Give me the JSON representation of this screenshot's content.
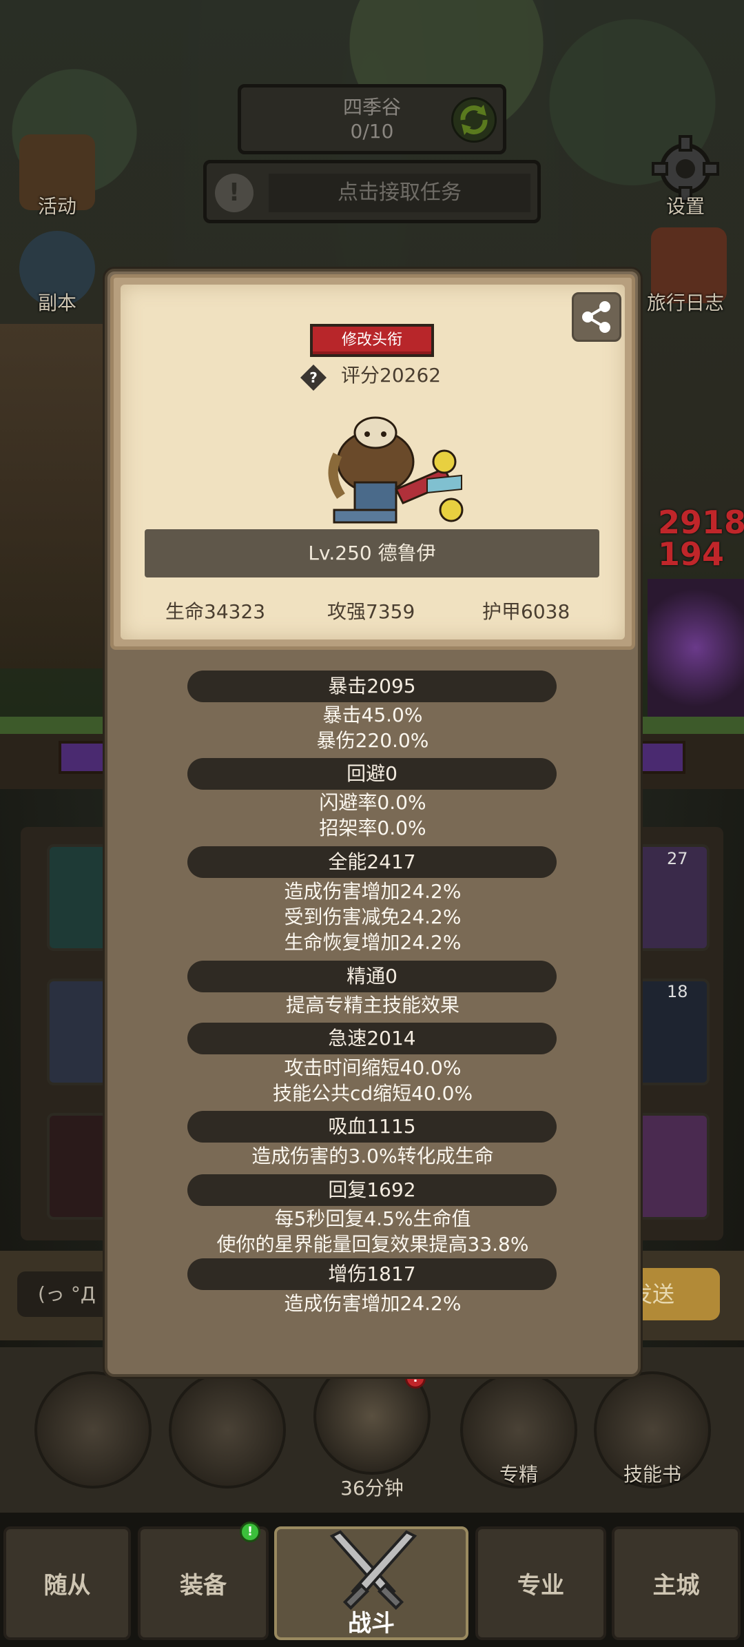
{
  "hud": {
    "map_name": "四季谷",
    "map_progress": "0/10",
    "quest_text": "点击接取任务",
    "quest_alert": "!"
  },
  "side_menu": {
    "activity": "活动",
    "dungeon": "副本",
    "settings": "设置",
    "travel_log": "旅行日志"
  },
  "background": {
    "damage_numbers": [
      "2918",
      "194"
    ],
    "tile_badges": [
      "27",
      "18"
    ],
    "chat_prefix": "(っ °Д °",
    "send_label": "发送",
    "timer": "36分钟",
    "round_buttons": [
      "",
      "",
      "",
      "专精",
      "技能书"
    ],
    "notification_count": "!"
  },
  "nav": {
    "tabs": [
      "随从",
      "装备",
      "战斗",
      "专业",
      "主城"
    ],
    "active": "战斗"
  },
  "profile": {
    "title_button": "修改头衔",
    "score": "评分20262",
    "help_glyph": "?",
    "name": "Lv.250 德鲁伊",
    "stats": {
      "hp": "生命34323",
      "attack": "攻强7359",
      "armor": "护甲6038"
    }
  },
  "sections": [
    {
      "title": "暴击2095",
      "lines": [
        "暴击45.0%",
        "暴伤220.0%"
      ]
    },
    {
      "title": "回避0",
      "lines": [
        "闪避率0.0%",
        "招架率0.0%"
      ]
    },
    {
      "title": "全能2417",
      "lines": [
        "造成伤害增加24.2%",
        "受到伤害减免24.2%",
        "生命恢复增加24.2%"
      ]
    },
    {
      "title": "精通0",
      "lines": [
        "提高专精主技能效果"
      ]
    },
    {
      "title": "急速2014",
      "lines": [
        "攻击时间缩短40.0%",
        "技能公共cd缩短40.0%"
      ]
    },
    {
      "title": "吸血1115",
      "lines": [
        "造成伤害的3.0%转化成生命"
      ]
    },
    {
      "title": "回复1692",
      "lines": [
        "每5秒回复4.5%生命值",
        "使你的星界能量回复效果提高33.8%"
      ]
    },
    {
      "title": "增伤1817",
      "lines": [
        "造成伤害增加24.2%"
      ]
    }
  ],
  "colors": {
    "title_button_red": "#b8262a",
    "parchment": "#f0e1c0",
    "modal_brown": "#7a6a55",
    "section_banner": "#2f2a23"
  },
  "icons": [
    "refresh-icon",
    "gear-icon",
    "activity-board-icon",
    "dungeon-portal-icon",
    "journal-icon",
    "share-icon",
    "help-icon",
    "crossed-swords-icon"
  ]
}
